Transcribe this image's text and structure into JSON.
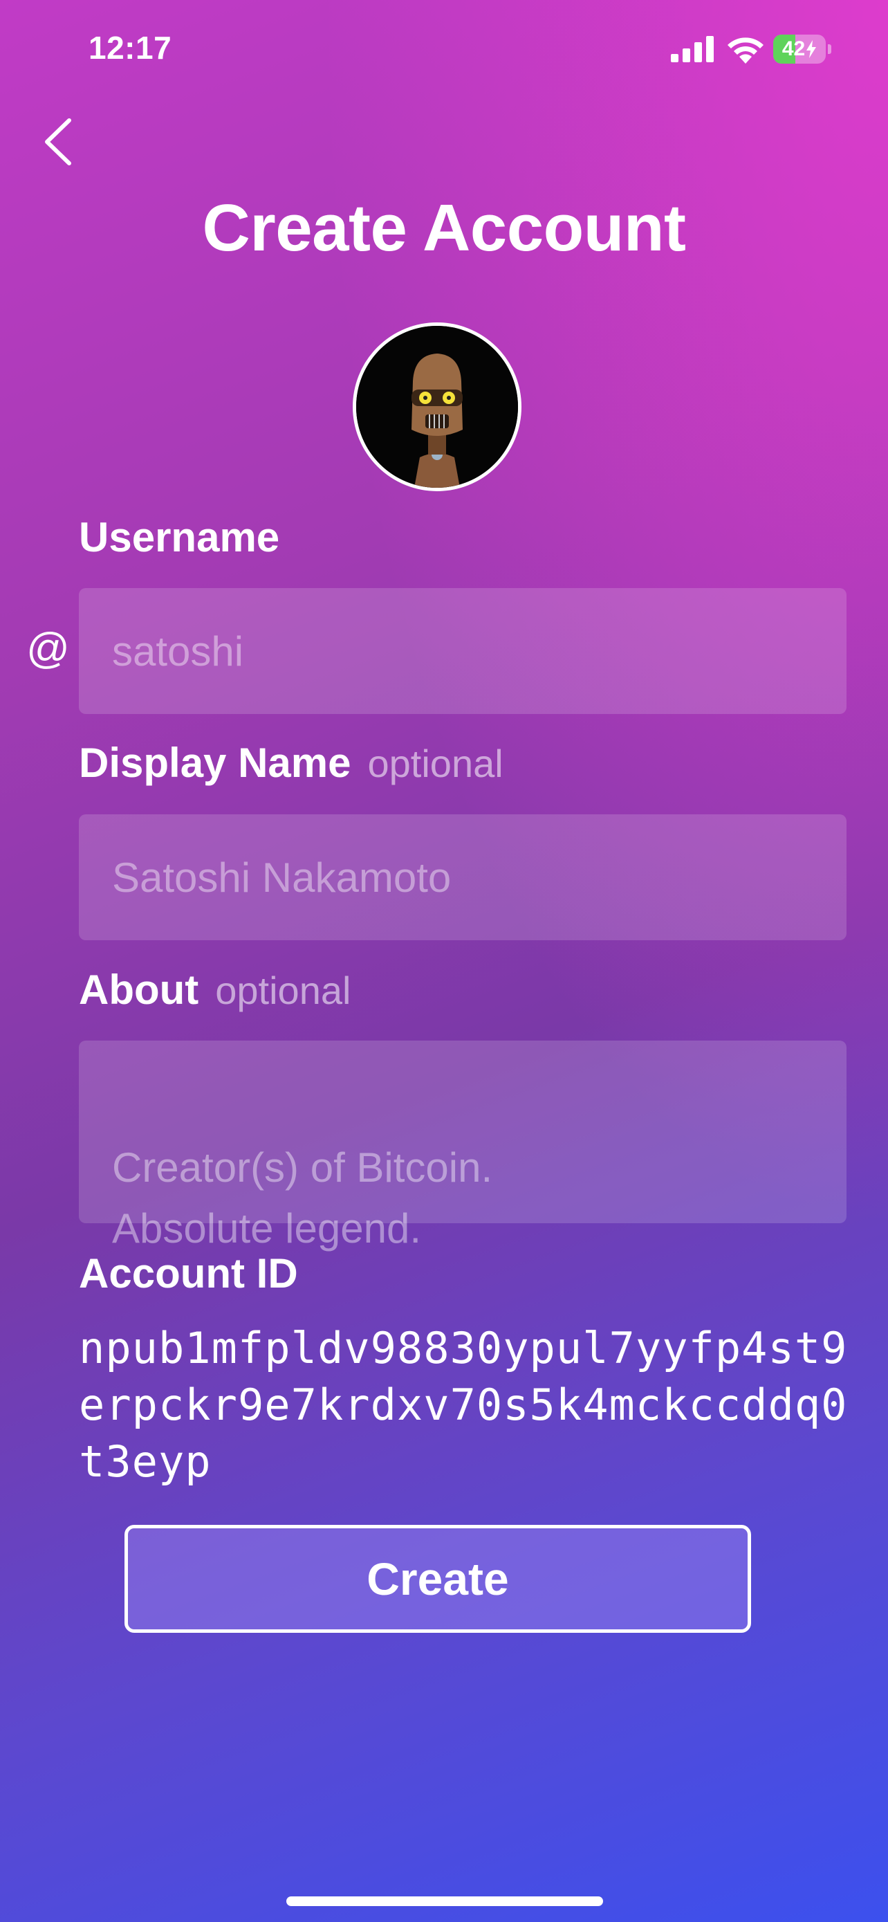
{
  "status_bar": {
    "time": "12:17",
    "battery_percent": 42,
    "battery_label": "42",
    "battery_color": "#5fd35a",
    "icons": [
      "signal-icon",
      "wifi-icon",
      "battery-icon"
    ]
  },
  "header": {
    "back_icon": "chevron-left-icon",
    "title": "Create Account"
  },
  "avatar": {
    "description_icon": "robot-avatar"
  },
  "form": {
    "username": {
      "label": "Username",
      "prefix": "@",
      "placeholder": "satoshi"
    },
    "display_name": {
      "label": "Display Name",
      "optional": "optional",
      "placeholder": "Satoshi Nakamoto"
    },
    "about": {
      "label": "About",
      "optional": "optional",
      "placeholder": "Creator(s) of Bitcoin.\nAbsolute legend."
    },
    "account_id": {
      "label": "Account ID",
      "value": "npub1mfpldv98830ypul7yyfp4st9erpckr9e7krdxv70s5k4mckccddq0t3eyp"
    }
  },
  "actions": {
    "create_label": "Create"
  },
  "colors": {
    "gradient_top": "#e13ad2",
    "gradient_mid": "#7a39a8",
    "gradient_bottom": "#3c50ee"
  }
}
